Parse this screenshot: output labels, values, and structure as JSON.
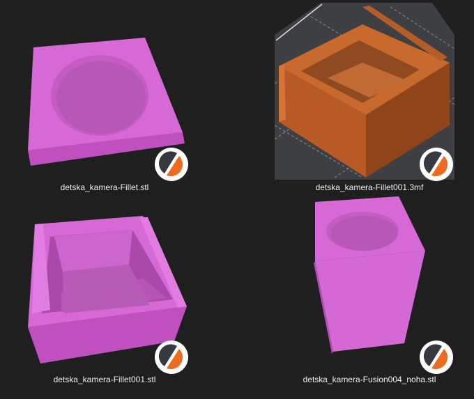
{
  "files": [
    {
      "name": "detska_kamera-Fillet.stl",
      "app_icon": "prusaslicer-icon"
    },
    {
      "name": "detska_kamera-Fillet001.3mf",
      "app_icon": "prusaslicer-icon"
    },
    {
      "name": "detska_kamera-Fillet001.stl",
      "app_icon": "prusaslicer-icon"
    },
    {
      "name": "detska_kamera-Fusion004_noha.stl",
      "app_icon": "prusaslicer-icon"
    }
  ],
  "colors": {
    "background": "#1f1f1f",
    "stl_model": "#d466d4",
    "3mf_model": "#c0622c",
    "badge_orange": "#ee6a1e",
    "badge_dark": "#363a40"
  }
}
